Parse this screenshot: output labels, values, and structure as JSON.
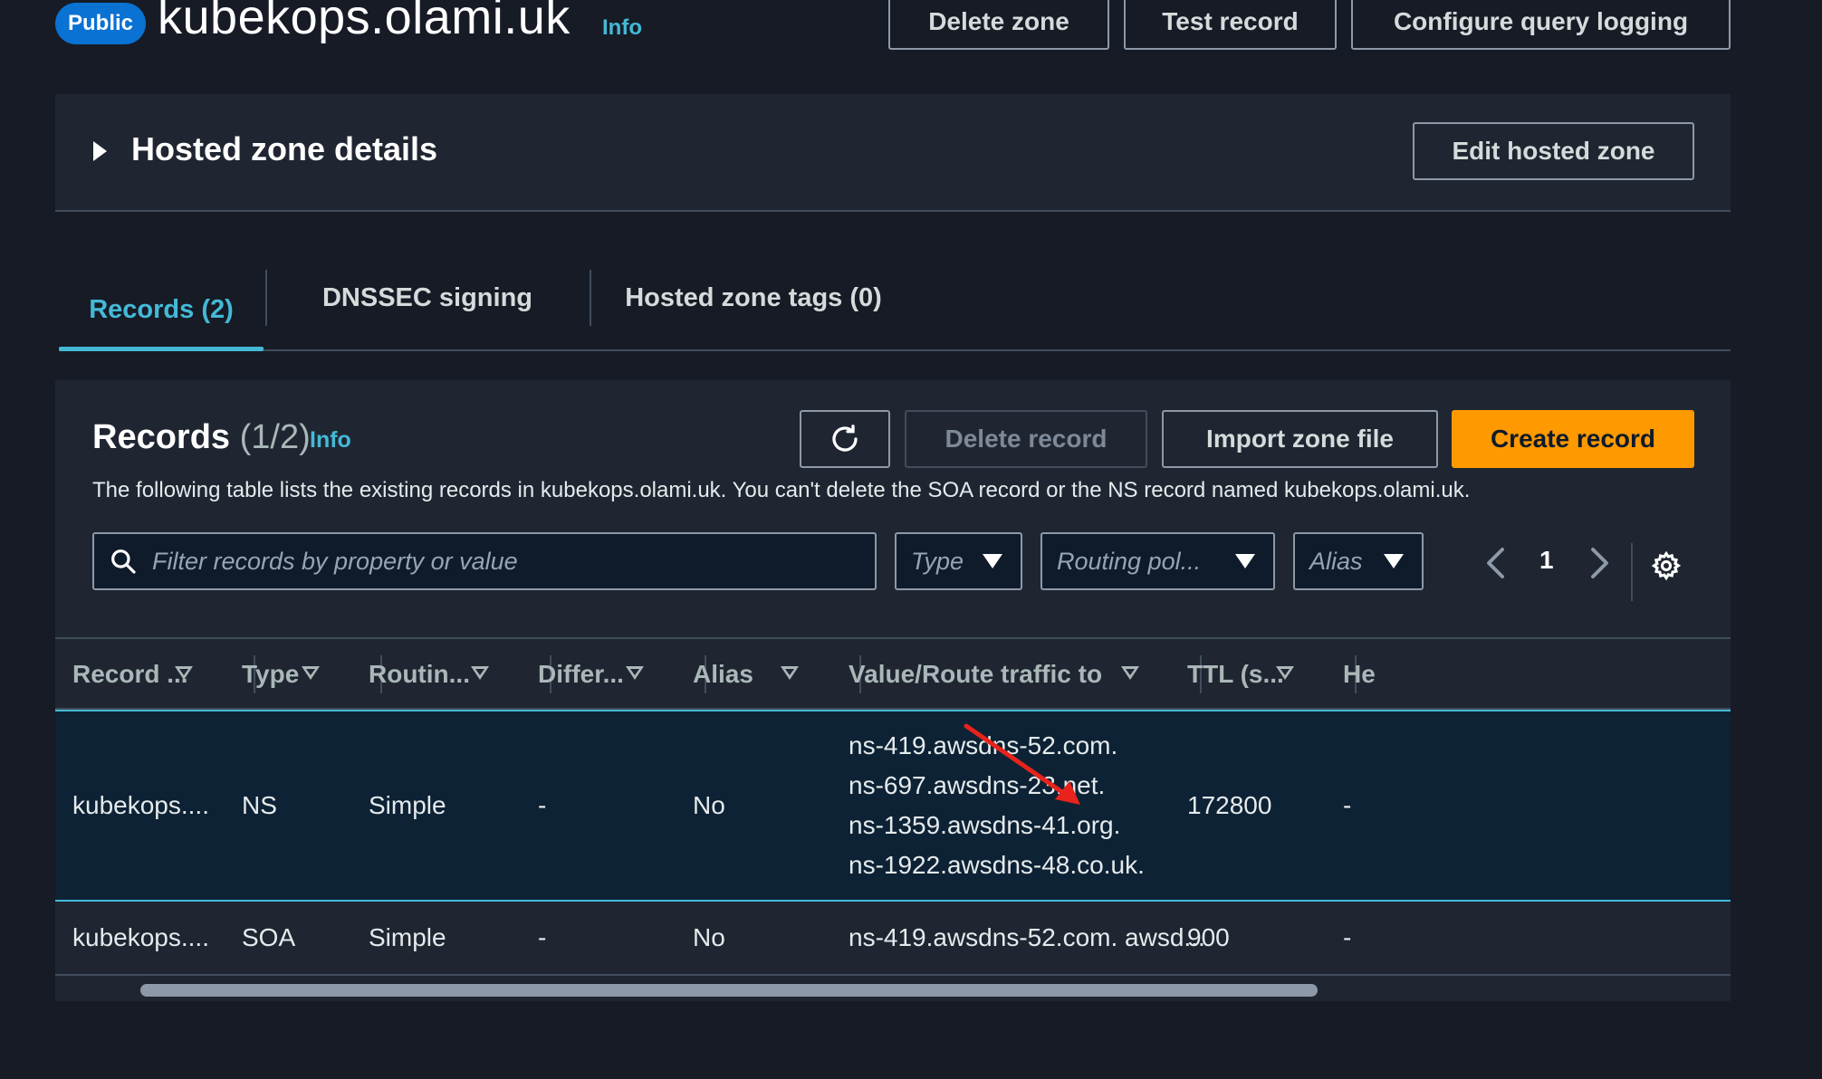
{
  "header": {
    "badge": "Public",
    "zone_name": "kubekops.olami.uk",
    "info": "Info",
    "buttons": {
      "delete_zone": "Delete zone",
      "test_record": "Test record",
      "configure_query_logging": "Configure query logging"
    }
  },
  "details": {
    "title": "Hosted zone details",
    "edit_button": "Edit hosted zone"
  },
  "tabs": [
    {
      "label": "Records (2)",
      "active": true
    },
    {
      "label": "DNSSEC signing",
      "active": false
    },
    {
      "label": "Hosted zone tags (0)",
      "active": false
    }
  ],
  "records": {
    "title": "Records",
    "count": "(1/2)",
    "info": "Info",
    "description": "The following table lists the existing records in kubekops.olami.uk. You can't delete the SOA record or the NS record named kubekops.olami.uk.",
    "buttons": {
      "refresh_icon": "refresh-icon",
      "delete_record": "Delete record",
      "import_zone_file": "Import zone file",
      "create_record": "Create record"
    },
    "filter": {
      "placeholder": "Filter records by property or value",
      "value": ""
    },
    "selects": {
      "type": "Type",
      "routing": "Routing pol...",
      "alias": "Alias"
    },
    "pagination": {
      "current_page": "1"
    },
    "columns": [
      "Record ...",
      "Type",
      "Routin...",
      "Differ...",
      "Alias",
      "Value/Route traffic to",
      "TTL (s...",
      "He"
    ],
    "rows": [
      {
        "name": "kubekops....",
        "type": "NS",
        "routing": "Simple",
        "differ": "-",
        "alias": "No",
        "values": [
          "ns-419.awsdns-52.com.",
          "ns-697.awsdns-23.net.",
          "ns-1359.awsdns-41.org.",
          "ns-1922.awsdns-48.co.uk."
        ],
        "ttl": "172800",
        "health": "-",
        "selected": true
      },
      {
        "name": "kubekops....",
        "type": "SOA",
        "routing": "Simple",
        "differ": "-",
        "alias": "No",
        "values": [
          "ns-419.awsdns-52.com. awsd..."
        ],
        "ttl": "900",
        "health": "-",
        "selected": false
      }
    ]
  },
  "colors": {
    "background": "#161b25",
    "panel": "#1f2631",
    "accent_link": "#44b9d6",
    "primary_button": "#ff9900",
    "badge": "#0972d3",
    "selected_row": "#0d2234",
    "annotation_arrow": "#e8231c"
  }
}
